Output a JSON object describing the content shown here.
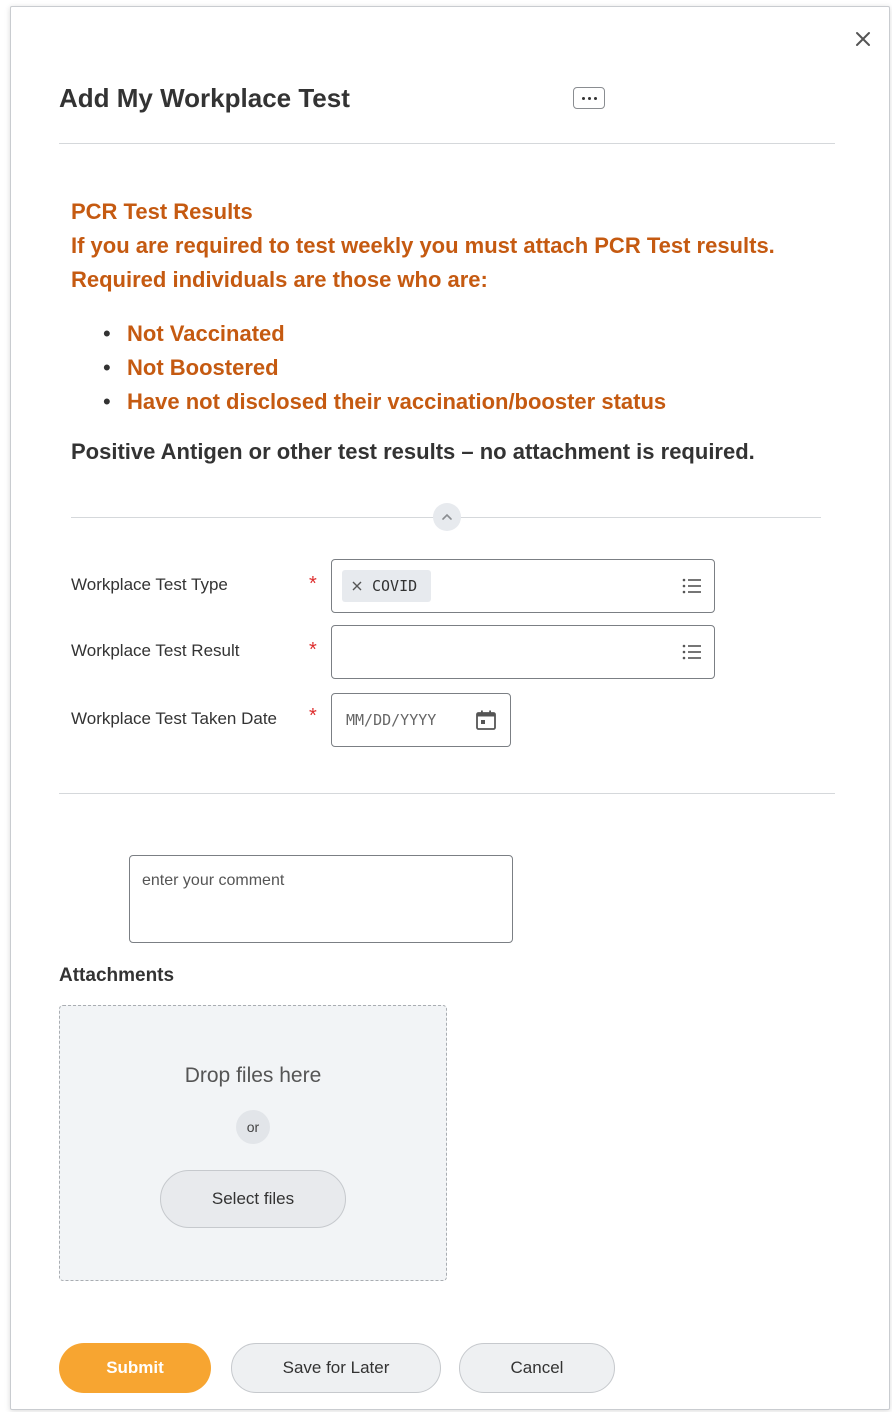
{
  "dialog": {
    "title": "Add My Workplace Test"
  },
  "notice": {
    "heading": "PCR Test Results",
    "line1": "If you are required to test weekly you must attach PCR Test results.",
    "line2": "Required individuals are those who are:",
    "items": [
      "Not Vaccinated",
      "Not Boostered",
      "Have not disclosed their vaccination/booster status"
    ],
    "positive_note": "Positive Antigen or other test results – no attachment is required."
  },
  "form": {
    "required_mark": "*",
    "test_type": {
      "label": "Workplace Test Type",
      "selected": "COVID"
    },
    "test_result": {
      "label": "Workplace Test Result",
      "selected": ""
    },
    "test_date": {
      "label": "Workplace Test Taken Date",
      "placeholder": "MM/DD/YYYY"
    }
  },
  "comment": {
    "placeholder": "enter your comment"
  },
  "attachments": {
    "label": "Attachments",
    "drop_text": "Drop files here",
    "or_text": "or",
    "select_label": "Select files"
  },
  "actions": {
    "submit": "Submit",
    "save_for_later": "Save for Later",
    "cancel": "Cancel"
  },
  "colors": {
    "notice_text": "#c55a11",
    "required": "#de2e2e",
    "primary_button": "#f7a531"
  }
}
